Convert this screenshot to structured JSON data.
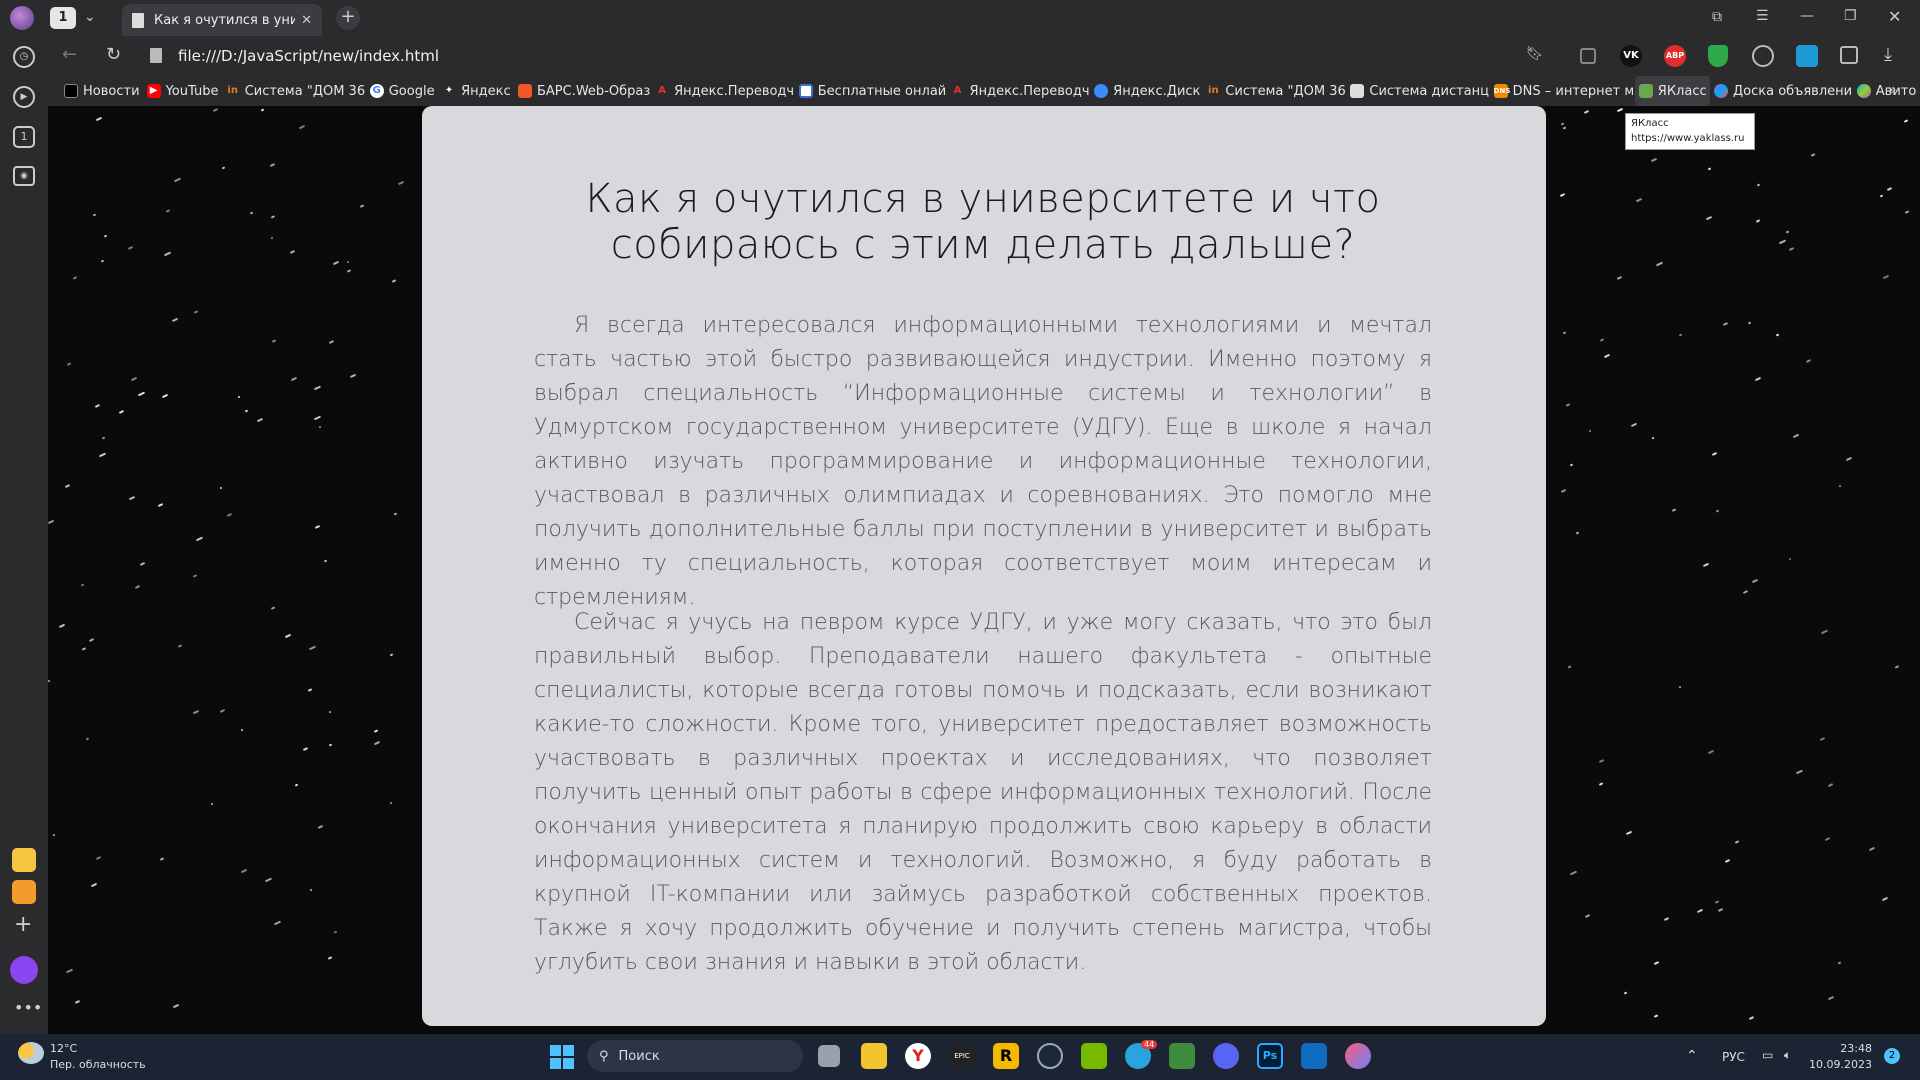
{
  "browser": {
    "tab_count": "1",
    "tab_title": "Как я очутился в униве",
    "url": "file:///D:/JavaScript/new/index.html",
    "bookmarks": [
      {
        "label": "Новости",
        "icon": "news-icon",
        "color": "#000000"
      },
      {
        "label": "YouTube",
        "icon": "youtube-icon",
        "color": "#ff0000"
      },
      {
        "label": "Система \"ДОМ 36",
        "icon": "dom-icon",
        "color": "#e87a1e"
      },
      {
        "label": "Google",
        "icon": "google-icon",
        "color": "#ffffff"
      },
      {
        "label": "Яндекс",
        "icon": "yandex-icon",
        "color": "#ffffff"
      },
      {
        "label": "БАРС.Web-Образ",
        "icon": "bars-icon",
        "color": "#ef5a24"
      },
      {
        "label": "Яндекс.Переводч",
        "icon": "translate-icon",
        "color": "#e0332b"
      },
      {
        "label": "Бесплатные онлай",
        "icon": "shield-doc-icon",
        "color": "#3b6ed9"
      },
      {
        "label": "Яндекс.Переводч",
        "icon": "translate-icon",
        "color": "#e0332b"
      },
      {
        "label": "Яндекс.Диск",
        "icon": "disk-icon",
        "color": "#3d8bfd"
      },
      {
        "label": "Система \"ДОМ 36",
        "icon": "dom-icon",
        "color": "#e87a1e"
      },
      {
        "label": "Система дистанц",
        "icon": "page-icon",
        "color": "#dddddd"
      },
      {
        "label": "DNS – интернет м",
        "icon": "dns-icon",
        "color": "#f08a00"
      },
      {
        "label": "ЯКласс",
        "icon": "folder-icon",
        "color": "#6aa84f"
      },
      {
        "label": "Доска объявлени",
        "icon": "avito-icon",
        "color": "#a060e0"
      },
      {
        "label": "Авито",
        "icon": "avito-icon",
        "color": "#00aaff"
      }
    ],
    "tooltip": {
      "title": "ЯКласс",
      "url": "https://www.yaklass.ru"
    }
  },
  "article": {
    "heading": "Как я очутился в университете и что собираюсь с этим делать дальше?",
    "paragraphs": [
      "Я всегда интересовался информационными технологиями и мечтал стать частью этой быстро развивающейся индустрии. Именно поэтому я выбрал специальность “Информационные системы и технологии” в Удмуртском государственном университете (УДГУ). Еще в школе я начал активно изучать программирование и информационные технологии, участвовал в различных олимпиадах и соревнованиях. Это помогло мне получить дополнительные баллы при поступлении в университет и выбрать именно ту специальность, которая соответствует моим интересам и стремлениям.",
      "Сейчас я учусь на певром курсе УДГУ, и уже могу сказать, что это был правильный выбор. Преподаватели нашего факультета - опытные специалисты, которые всегда готовы помочь и подсказать, если возникают какие-то сложности. Кроме того, университет предоставляет возможность участвовать в различных проектах и исследованиях, что позволяет получить ценный опыт работы в сфере информационных технологий. После окончания университета я планирую продолжить свою карьеру в области информационных систем и технологий. Возможно, я буду работать в крупной IT-компании или займусь разработкой собственных проектов. Также я хочу продолжить обучение и получить степень магистра, чтобы углубить свои знания и навыки в этой области."
    ]
  },
  "taskbar": {
    "weather_temp": "12°C",
    "weather_desc": "Пер. облачность",
    "search_label": "Поиск",
    "language": "РУС",
    "time": "23:48",
    "date": "10.09.2023",
    "notification_count": "2",
    "telegram_badge": "44"
  }
}
